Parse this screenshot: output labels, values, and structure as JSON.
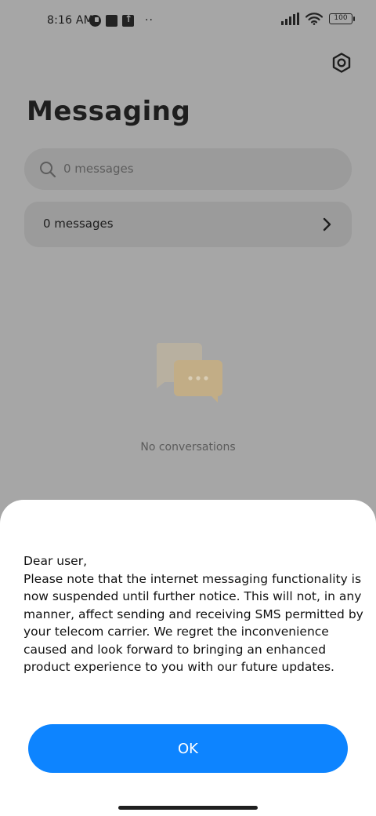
{
  "status_bar": {
    "time": "8:16 AM",
    "battery": "100",
    "more": "··"
  },
  "header": {
    "title": "Messaging",
    "settings_icon": "settings-hexagon-icon"
  },
  "search": {
    "placeholder": "0 messages",
    "icon": "search-icon"
  },
  "messages_row": {
    "label": "0 messages",
    "icon": "chevron-right-icon"
  },
  "empty_state": {
    "text": "No conversations",
    "illustration": "chat-bubbles-icon",
    "colors": {
      "back_bubble": "#b8b0a0",
      "front_bubble": "#c2ad86"
    }
  },
  "dialog": {
    "message": "Dear user,\nPlease note that the internet messaging functionality is now suspended until further notice. This will not, in any manner, affect sending and receiving SMS permitted by your telecom carrier. We regret the inconvenience caused and look forward to bringing an enhanced product experience to you with our future updates.",
    "ok_label": "OK",
    "accent_color": "#0d84ff"
  },
  "colors": {
    "scrim": "#a6a6a6",
    "sheet": "#ffffff"
  }
}
